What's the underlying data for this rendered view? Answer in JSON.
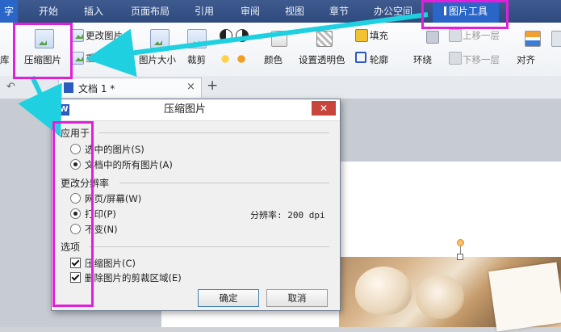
{
  "menubar": {
    "tabs": [
      "字",
      "开始",
      "插入",
      "页面布局",
      "引用",
      "审阅",
      "视图",
      "章节",
      "办公空间",
      "图片工具"
    ],
    "active_tab": "图片工具"
  },
  "ribbon": {
    "left_cut": "库",
    "compress_label": "压缩图片",
    "change_pic": "更改图片",
    "reset_pic": "重设图片",
    "pic_size": "图片大小",
    "crop": "裁剪",
    "color": "颜色",
    "set_transparent": "设置透明色",
    "fill": "填充",
    "outline": "轮廓",
    "wrap": "环绕",
    "move_up": "上移一层",
    "move_down": "下移一层",
    "align": "对齐"
  },
  "tabbar": {
    "doc_tab": "文档 1 *",
    "close": "×",
    "new": "+"
  },
  "dialog": {
    "title": "压缩图片",
    "close": "✕",
    "logo": "W",
    "apply_section": "应用于",
    "apply_selected": "选中的图片(S)",
    "apply_all": "文档中的所有图片(A)",
    "resolution_section": "更改分辨率",
    "res_web": "网页/屏幕(W)",
    "res_print": "打印(P)",
    "res_nochange": "不变(N)",
    "dpi_text": "分辨率: 200 dpi",
    "options_section": "选项",
    "opt_compress": "压缩图片(C)",
    "opt_delete_crop": "删除图片的剪裁区域(E)",
    "ok": "确定",
    "cancel": "取消"
  },
  "colors": {
    "highlight": "#e020d8",
    "arrow": "#1fd0e0",
    "menubar": "#3f5a8f",
    "active_tab": "#2a66c8"
  }
}
